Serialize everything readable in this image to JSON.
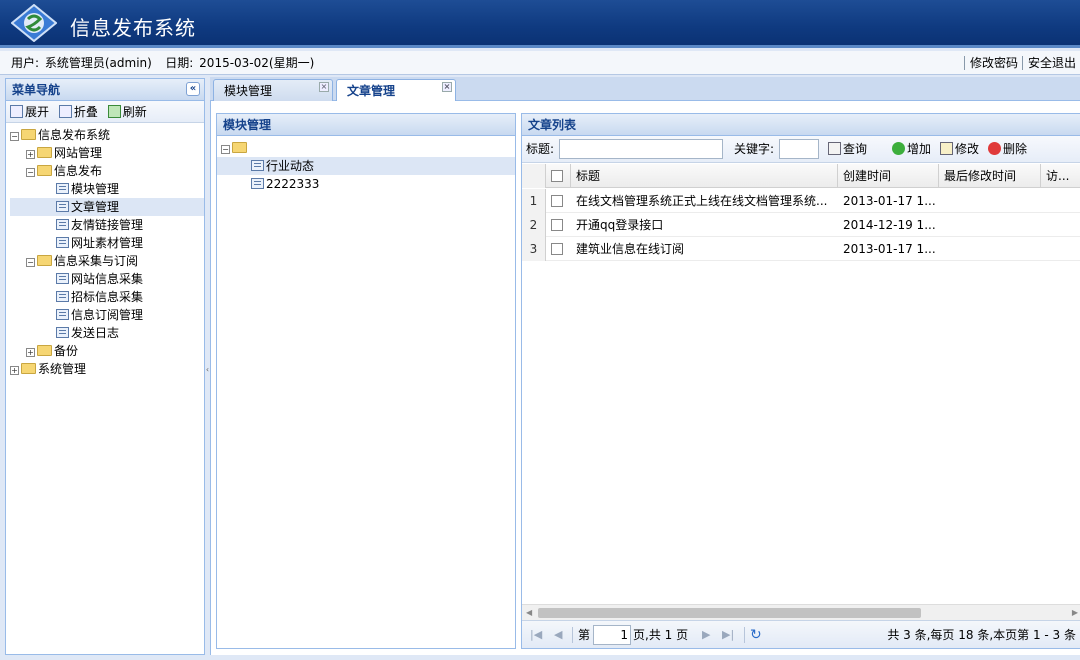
{
  "app": {
    "title": "信息发布系统"
  },
  "infobar": {
    "user_label": "用户:",
    "user_value": "系统管理员(admin)",
    "date_label": "日期:",
    "date_value": "2015-03-02(星期一)",
    "change_password": "修改密码",
    "logout": "安全退出"
  },
  "menu": {
    "title": "菜单导航",
    "expand": "展开",
    "collapse": "折叠",
    "refresh": "刷新",
    "tree": {
      "root": "信息发布系统",
      "website_mgmt": "网站管理",
      "info_publish": "信息发布",
      "module_mgmt": "模块管理",
      "article_mgmt": "文章管理",
      "friend_links": "友情链接管理",
      "url_material": "网址素材管理",
      "collect_subscribe": "信息采集与订阅",
      "site_collect": "网站信息采集",
      "bid_collect": "招标信息采集",
      "subscribe_mgmt": "信息订阅管理",
      "send_log": "发送日志",
      "backup": "备份",
      "system_mgmt": "系统管理"
    }
  },
  "tabs": [
    {
      "label": "模块管理"
    },
    {
      "label": "文章管理"
    }
  ],
  "module_panel": {
    "title": "模块管理",
    "children": [
      "行业动态",
      "2222333"
    ]
  },
  "article_panel": {
    "title": "文章列表",
    "search_title_label": "标题:",
    "search_title_value": "",
    "keyword_label": "关键字:",
    "keyword_value": "",
    "query": "查询",
    "add": "增加",
    "edit": "修改",
    "delete": "删除",
    "columns": [
      "标题",
      "创建时间",
      "最后修改时间",
      "访..."
    ],
    "rows": [
      {
        "n": "1",
        "title": "在线文档管理系统正式上线在线文档管理系统...",
        "created": "2013-01-17 1...",
        "modified": ""
      },
      {
        "n": "2",
        "title": "开通qq登录接口",
        "created": "2014-12-19 1...",
        "modified": ""
      },
      {
        "n": "3",
        "title": "建筑业信息在线订阅",
        "created": "2013-01-17 1...",
        "modified": ""
      }
    ],
    "pager": {
      "page_prefix": "第",
      "page_value": "1",
      "page_suffix": "页,共 1 页",
      "summary": "共 3 条,每页 18 条,本页第 1 - 3 条"
    }
  },
  "colors": {
    "header": "#0f3a80",
    "panel_border": "#99bbe8",
    "panel_title": "#15428b"
  }
}
